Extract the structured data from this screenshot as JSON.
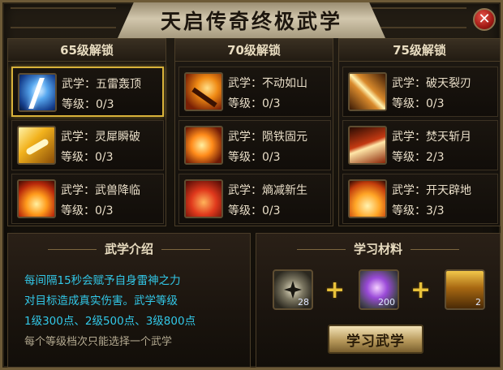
{
  "window": {
    "title": "天启传奇终极武学",
    "close_label": "✕"
  },
  "columns": [
    {
      "header": "65级解锁",
      "skills": [
        {
          "name": "武学：五雷轰顶",
          "level": "等级：0/3",
          "icon": "lightning-icon"
        },
        {
          "name": "武学：灵犀瞬破",
          "level": "等级：0/3",
          "icon": "golden-strike-icon"
        },
        {
          "name": "武学：武兽降临",
          "level": "等级：0/3",
          "icon": "fire-beast-icon"
        }
      ]
    },
    {
      "header": "70级解锁",
      "skills": [
        {
          "name": "武学：不动如山",
          "level": "等级：0/3",
          "icon": "ember-stance-icon"
        },
        {
          "name": "武学：陨铁固元",
          "level": "等级：0/3",
          "icon": "meteor-iron-icon"
        },
        {
          "name": "武学：熵减新生",
          "level": "等级：0/3",
          "icon": "crimson-rebirth-icon"
        }
      ]
    },
    {
      "header": "75级解锁",
      "skills": [
        {
          "name": "武学：破天裂刃",
          "level": "等级：0/3",
          "icon": "splitting-blade-icon"
        },
        {
          "name": "武学：焚天斩月",
          "level": "等级：2/3",
          "icon": "moon-slash-icon"
        },
        {
          "name": "武学：开天辟地",
          "level": "等级：3/3",
          "icon": "heaven-flame-icon"
        }
      ]
    }
  ],
  "info": {
    "header": "武学介绍",
    "lines": [
      "每间隔15秒会赋予自身雷神之力",
      "对目标造成真实伤害。武学等级",
      "1级300点、2级500点、3级800点"
    ],
    "note": "每个等级档次只能选择一个武学"
  },
  "materials": {
    "header": "学习材料",
    "items": [
      {
        "icon": "shuriken-icon",
        "qty": "28"
      },
      {
        "icon": "purple-ore-icon",
        "qty": "200"
      },
      {
        "icon": "treasure-chest-icon",
        "qty": "2"
      }
    ],
    "plus": "+",
    "learn_button": "学习武学"
  },
  "selected_skill": "武学：五雷轰顶",
  "colors": {
    "accent_gold": "#d8b23a",
    "description_cyan": "#32c8e8",
    "text_light": "#e9dec8"
  }
}
